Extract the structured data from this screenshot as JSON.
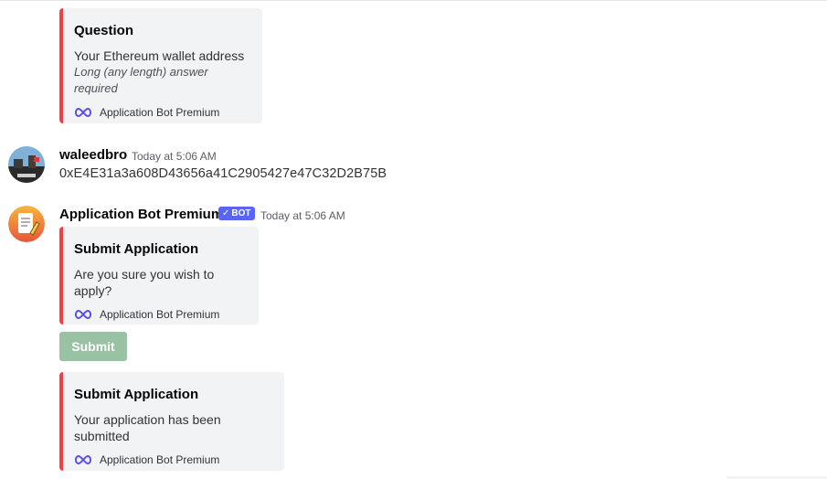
{
  "embed_question": {
    "title": "Question",
    "description": "Your Ethereum wallet address",
    "subtext": "Long (any length) answer required",
    "footer": "Application Bot Premium"
  },
  "message_user": {
    "username": "waleedbro",
    "timestamp": "Today at 5:06 AM",
    "text": "0xE4E31a3a608D43656a41C2905427e47C32D2B75B"
  },
  "message_bot": {
    "username": "Application Bot Premium",
    "bot_tag": "BOT",
    "timestamp": "Today at 5:06 AM"
  },
  "embed_confirm": {
    "title": "Submit Application",
    "description": "Are you sure you wish to apply?",
    "footer": "Application Bot Premium"
  },
  "submit_button": {
    "label": "Submit"
  },
  "embed_submitted": {
    "title": "Submit Application",
    "description": "Your application has been submitted",
    "footer": "Application Bot Premium"
  },
  "colors": {
    "embed_border": "#f23f43",
    "embed_bg": "#f2f3f5",
    "bot_tag": "#5865f2",
    "submit_button_disabled": "#98c2a3"
  }
}
